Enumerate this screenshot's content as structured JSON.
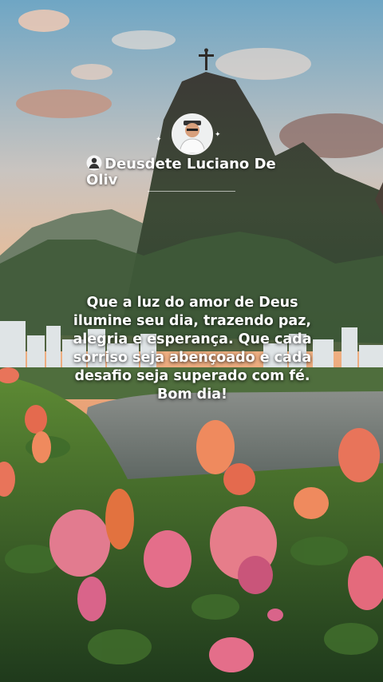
{
  "profile": {
    "name": "Deusdete Luciano De Oliv",
    "avatar_icon": "profile-photo",
    "badge_icon": "person-silhouette-icon"
  },
  "message": {
    "text": "Que a luz do amor de Deus ilumine seu dia, trazendo paz, alegria e esperança. Que cada sorriso seja abençoado e cada desafio seja superado com fé. Bom dia!"
  },
  "colors": {
    "sky_top": "#6fa6c4",
    "sky_bottom": "#f2b07a",
    "flower": "#e8745a",
    "text": "#ffffff"
  }
}
